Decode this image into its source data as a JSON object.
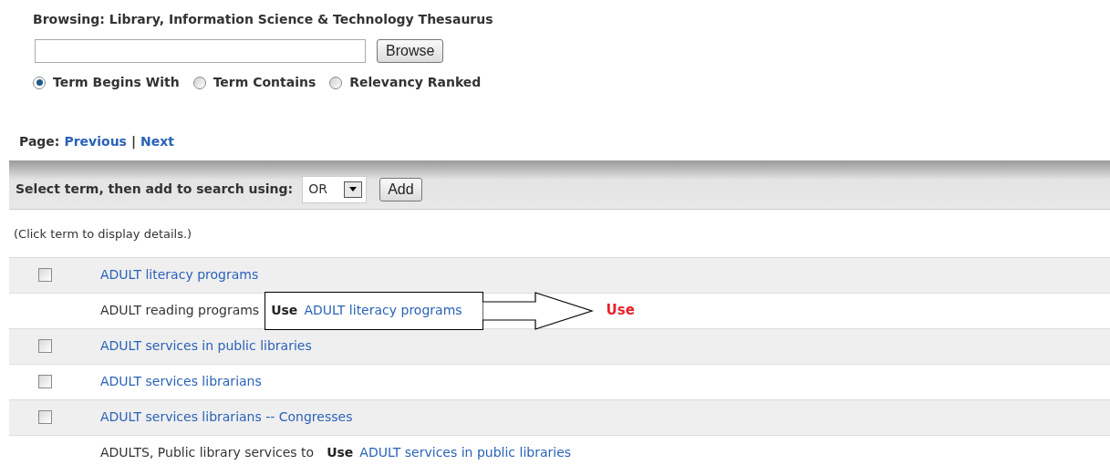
{
  "browse": {
    "title": "Browsing: Library, Information Science & Technology Thesaurus",
    "button": "Browse",
    "modes": [
      {
        "label": "Term Begins With",
        "selected": true
      },
      {
        "label": "Term Contains",
        "selected": false
      },
      {
        "label": "Relevancy Ranked",
        "selected": false
      }
    ]
  },
  "pager": {
    "label": "Page:",
    "previous": "Previous",
    "separator": "|",
    "next": "Next"
  },
  "toolbar": {
    "label": "Select term, then add to search using:",
    "operator": "OR",
    "button": "Add"
  },
  "hint": "(Click term to display details.)",
  "terms": [
    {
      "kind": "term",
      "term": "ADULT literacy programs",
      "checked": false
    },
    {
      "kind": "use",
      "term": "ADULT reading programs",
      "use_label": "Use",
      "target": "ADULT literacy programs",
      "callout": "Use"
    },
    {
      "kind": "term",
      "term": "ADULT services in public libraries",
      "checked": false
    },
    {
      "kind": "term",
      "term": "ADULT services librarians",
      "checked": false
    },
    {
      "kind": "term",
      "term": "ADULT services librarians -- Congresses",
      "checked": false
    },
    {
      "kind": "use",
      "term": "ADULTS, Public library services to",
      "use_label": "Use",
      "target": "ADULT services in public libraries"
    }
  ]
}
